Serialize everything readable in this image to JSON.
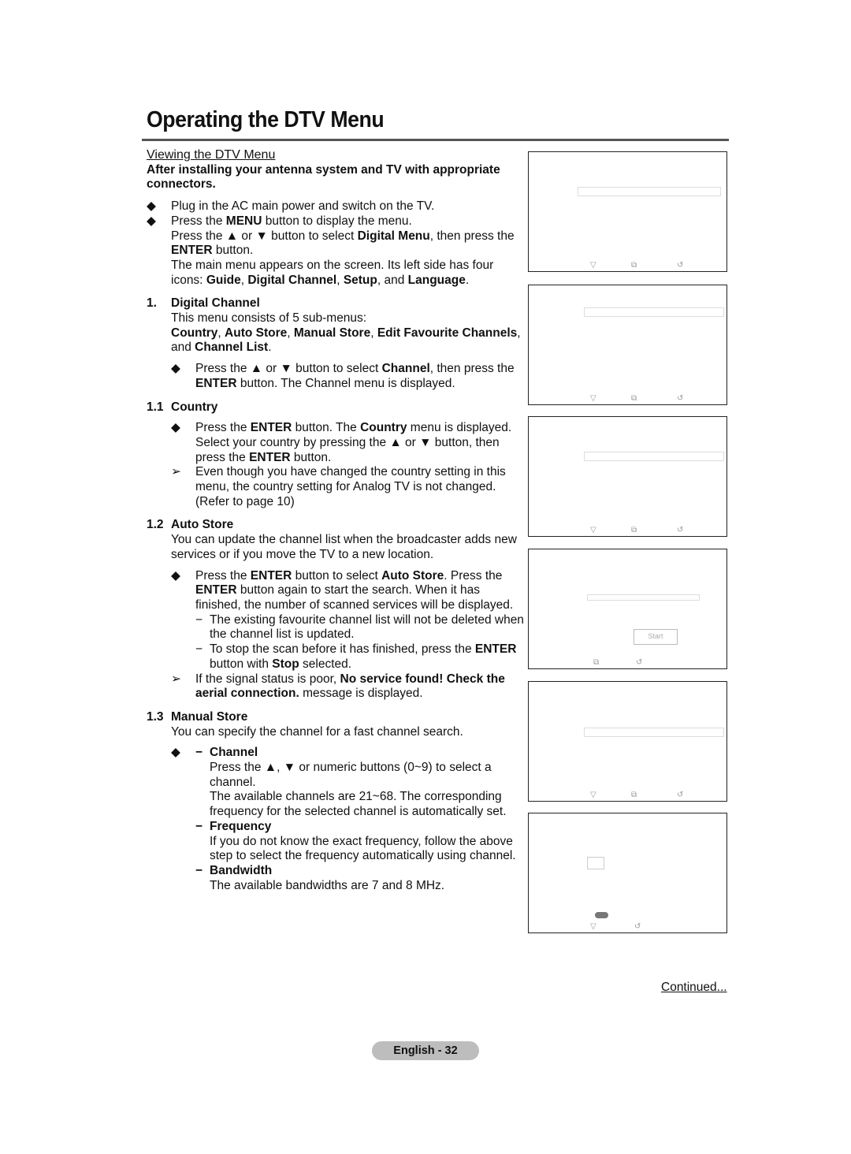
{
  "page": {
    "title": "Operating the DTV Menu",
    "continued": "Continued...",
    "page_label": "English - 32"
  },
  "intro": {
    "heading": "Viewing the DTV Menu",
    "lead": "After installing your antenna system and TV with appropriate connectors.",
    "bullets": [
      {
        "segments": [
          {
            "t": "Plug in the AC main power and switch on the TV.",
            "b": false
          }
        ]
      },
      {
        "segments": [
          {
            "t": "Press the ",
            "b": false
          },
          {
            "t": "MENU",
            "b": true
          },
          {
            "t": " button to display the menu.",
            "b": false
          }
        ]
      }
    ],
    "para1": [
      {
        "t": "Press the ▲ or ▼ button to select ",
        "b": false
      },
      {
        "t": "Digital Menu",
        "b": true
      },
      {
        "t": ", then press the ",
        "b": false
      },
      {
        "t": "ENTER",
        "b": true
      },
      {
        "t": " button.",
        "b": false
      }
    ],
    "para2": [
      {
        "t": "The main menu appears on the screen. Its left side has four icons: ",
        "b": false
      },
      {
        "t": "Guide",
        "b": true
      },
      {
        "t": ", ",
        "b": false
      },
      {
        "t": "Digital Channel",
        "b": true
      },
      {
        "t": ", ",
        "b": false
      },
      {
        "t": "Setup",
        "b": true
      },
      {
        "t": ", and ",
        "b": false
      },
      {
        "t": "Language",
        "b": true
      },
      {
        "t": ".",
        "b": false
      }
    ]
  },
  "section1": {
    "num": "1.",
    "title": "Digital Channel",
    "text": "This menu consists of 5 sub-menus:",
    "submenus": [
      {
        "t": "Country",
        "b": true
      },
      {
        "t": ", ",
        "b": false
      },
      {
        "t": "Auto Store",
        "b": true
      },
      {
        "t": ", ",
        "b": false
      },
      {
        "t": "Manual Store",
        "b": true
      },
      {
        "t": ", ",
        "b": false
      },
      {
        "t": "Edit Favourite Channels",
        "b": true
      },
      {
        "t": ", and ",
        "b": false
      },
      {
        "t": "Channel List",
        "b": true
      },
      {
        "t": ".",
        "b": false
      }
    ],
    "bullet": [
      {
        "t": "Press the ▲ or ▼ button to select ",
        "b": false
      },
      {
        "t": "Channel",
        "b": true
      },
      {
        "t": ", then press the ",
        "b": false
      },
      {
        "t": "ENTER",
        "b": true
      },
      {
        "t": " button. The Channel menu is displayed.",
        "b": false
      }
    ]
  },
  "section11": {
    "num": "1.1",
    "title": "Country",
    "bullet": [
      {
        "t": "Press the ",
        "b": false
      },
      {
        "t": "ENTER",
        "b": true
      },
      {
        "t": " button. The ",
        "b": false
      },
      {
        "t": "Country",
        "b": true
      },
      {
        "t": " menu is displayed. Select your country by pressing the ▲ or ▼ button, then press the ",
        "b": false
      },
      {
        "t": "ENTER",
        "b": true
      },
      {
        "t": " button.",
        "b": false
      }
    ],
    "note": "Even though you have changed the country setting in this menu, the country setting for Analog TV is not changed.(Refer to page 10)"
  },
  "section12": {
    "num": "1.2",
    "title": "Auto Store",
    "text": "You can update the channel list when the broadcaster adds new services or if you move the TV to a new location.",
    "bullet": [
      {
        "t": "Press the ",
        "b": false
      },
      {
        "t": "ENTER",
        "b": true
      },
      {
        "t": " button to select ",
        "b": false
      },
      {
        "t": "Auto Store",
        "b": true
      },
      {
        "t": ". Press the ",
        "b": false
      },
      {
        "t": "ENTER",
        "b": true
      },
      {
        "t": " button again to start the search. When it has finished, the number of scanned services will be displayed.",
        "b": false
      }
    ],
    "dash1": "The existing favourite channel list will not be deleted when the channel list is updated.",
    "dash2": [
      {
        "t": "To stop the scan before it has finished, press the ",
        "b": false
      },
      {
        "t": "ENTER",
        "b": true
      },
      {
        "t": " button with ",
        "b": false
      },
      {
        "t": "Stop",
        "b": true
      },
      {
        "t": " selected.",
        "b": false
      }
    ],
    "note": [
      {
        "t": "If the signal status is poor, ",
        "b": false
      },
      {
        "t": "No service found! Check the aerial connection.",
        "b": true
      },
      {
        "t": " message is displayed.",
        "b": false
      }
    ]
  },
  "section13": {
    "num": "1.3",
    "title": "Manual Store",
    "text": "You can specify the channel for a fast channel search.",
    "items": [
      {
        "title": "Channel",
        "lines": [
          "Press the ▲, ▼ or numeric buttons (0~9) to select a channel.",
          "The available channels are 21~68. The corresponding frequency for the selected channel is automatically set."
        ]
      },
      {
        "title": "Frequency",
        "lines": [
          "If you do not know the exact frequency, follow the above step to select the frequency automatically using channel."
        ]
      },
      {
        "title": "Bandwidth",
        "lines": [
          "The available bandwidths are 7 and 8 MHz."
        ]
      }
    ]
  },
  "markers": {
    "bullet": "◆",
    "arrow": "➢",
    "dash": "−"
  },
  "screens": {
    "icons": {
      "move": "▽",
      "enter": "⧉",
      "return": "↺"
    },
    "autostore_button": "Start"
  }
}
